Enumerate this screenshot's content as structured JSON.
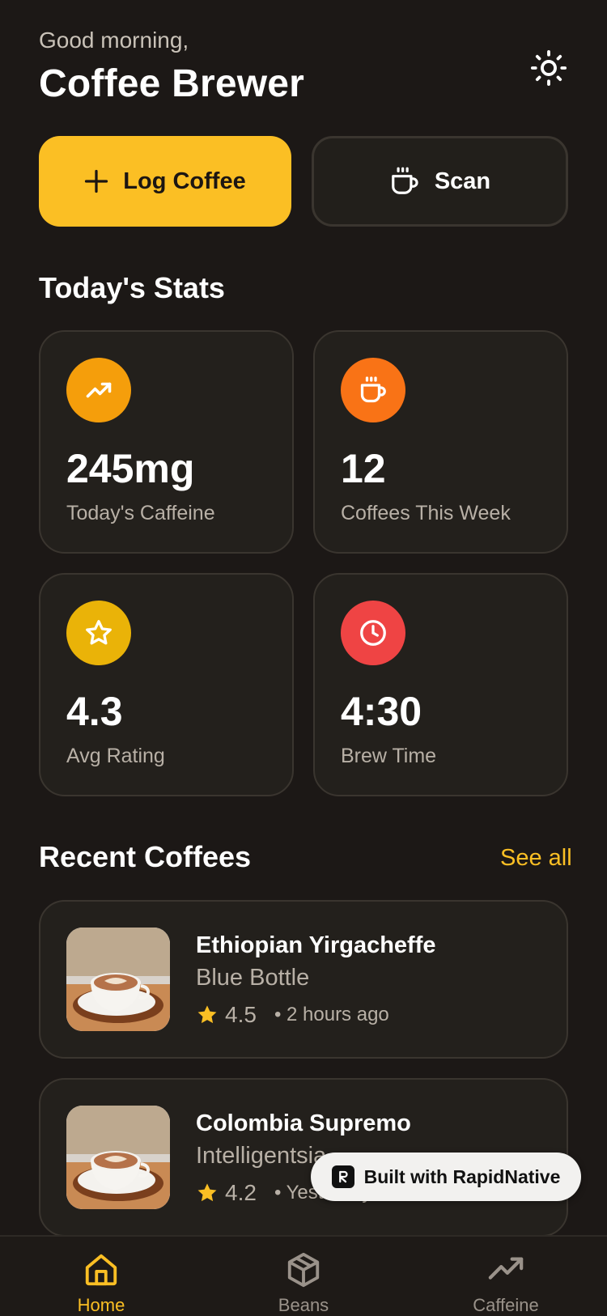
{
  "header": {
    "greeting": "Good morning,",
    "title": "Coffee Brewer"
  },
  "actions": {
    "log_label": "Log Coffee",
    "scan_label": "Scan"
  },
  "stats": {
    "title": "Today's Stats",
    "items": [
      {
        "value": "245mg",
        "label": "Today's Caffeine",
        "icon": "trending-up-icon",
        "color": "#f59e0b"
      },
      {
        "value": "12",
        "label": "Coffees This Week",
        "icon": "coffee-cup-icon",
        "color": "#f97316"
      },
      {
        "value": "4.3",
        "label": "Avg Rating",
        "icon": "star-icon",
        "color": "#eab308"
      },
      {
        "value": "4:30",
        "label": "Brew Time",
        "icon": "clock-icon",
        "color": "#ef4444"
      }
    ]
  },
  "recent": {
    "title": "Recent Coffees",
    "see_all": "See all",
    "items": [
      {
        "name": "Ethiopian Yirgacheffe",
        "brand": "Blue Bottle",
        "rating": "4.5",
        "time": "• 2 hours ago"
      },
      {
        "name": "Colombia Supremo",
        "brand": "Intelligentsia",
        "rating": "4.2",
        "time": "• Yesterday"
      }
    ]
  },
  "badge": {
    "label": "Built with RapidNative"
  },
  "tabs": [
    {
      "label": "Home",
      "icon": "home-icon",
      "active": true
    },
    {
      "label": "Beans",
      "icon": "box-icon",
      "active": false
    },
    {
      "label": "Caffeine",
      "icon": "trending-up-icon",
      "active": false
    }
  ],
  "colors": {
    "accent": "#fbbf24",
    "background": "#1c1816",
    "card": "#23201c"
  }
}
